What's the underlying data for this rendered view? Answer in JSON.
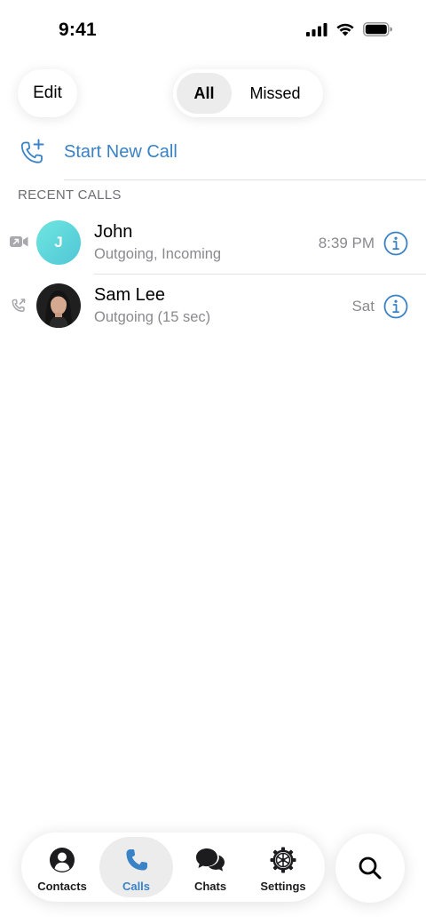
{
  "status_bar": {
    "time": "9:41",
    "icons": [
      "cellular-signal-icon",
      "wifi-icon",
      "battery-icon"
    ]
  },
  "header": {
    "edit_label": "Edit",
    "segments": [
      {
        "label": "All",
        "selected": true
      },
      {
        "label": "Missed",
        "selected": false
      }
    ]
  },
  "new_call": {
    "label": "Start New Call",
    "icon": "phone-plus-icon"
  },
  "recent_calls": {
    "section_title": "RECENT CALLS",
    "items": [
      {
        "name": "John",
        "detail": "Outgoing, Incoming",
        "time": "8:39 PM",
        "avatar_initial": "J",
        "call_type_icon": "video-call-icon"
      },
      {
        "name": "Sam Lee",
        "detail": "Outgoing (15 sec)",
        "time": "Sat",
        "avatar_initial": "",
        "call_type_icon": "outgoing-phone-icon"
      }
    ]
  },
  "tab_bar": {
    "tabs": [
      {
        "label": "Contacts",
        "icon": "person-circle-icon",
        "active": false
      },
      {
        "label": "Calls",
        "icon": "phone-icon",
        "active": true
      },
      {
        "label": "Chats",
        "icon": "chat-bubbles-icon",
        "active": false
      },
      {
        "label": "Settings",
        "icon": "gear-icon",
        "active": false
      }
    ],
    "search_icon": "search-icon"
  },
  "colors": {
    "accent": "#3a82c6",
    "secondary_text": "#8a8a8e",
    "avatar_gradient": "#5fd6dc"
  }
}
